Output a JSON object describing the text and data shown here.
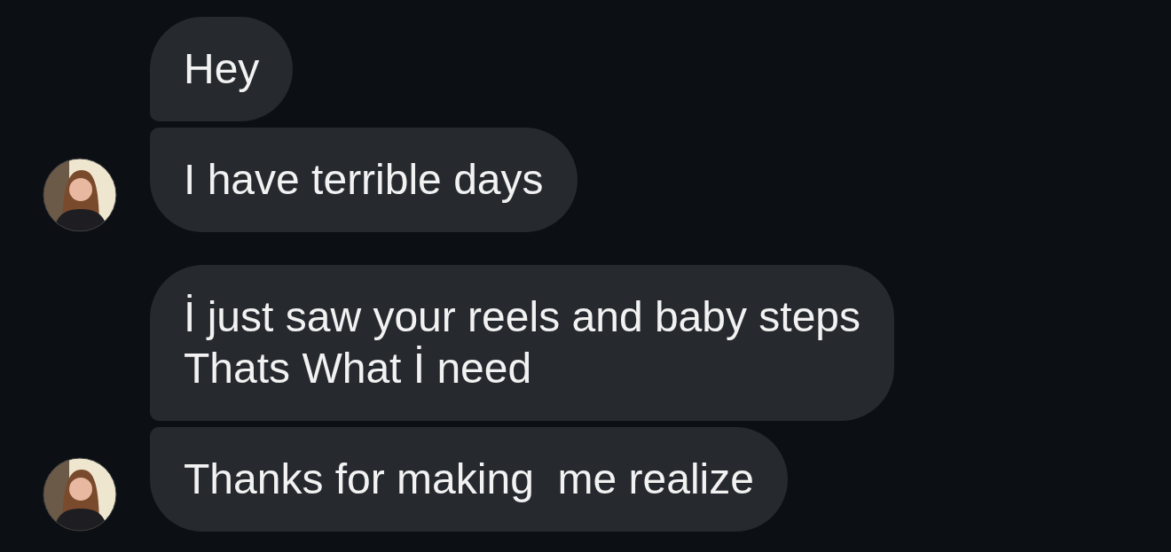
{
  "groups": [
    {
      "messages": [
        {
          "text": "Hey",
          "show_avatar": false
        },
        {
          "text": "I have terrible days",
          "show_avatar": true
        }
      ]
    },
    {
      "messages": [
        {
          "text": "İ just saw your reels and baby steps\nThats What İ need",
          "show_avatar": false
        },
        {
          "text": "Thanks for making  me realize",
          "show_avatar": true
        }
      ]
    }
  ]
}
